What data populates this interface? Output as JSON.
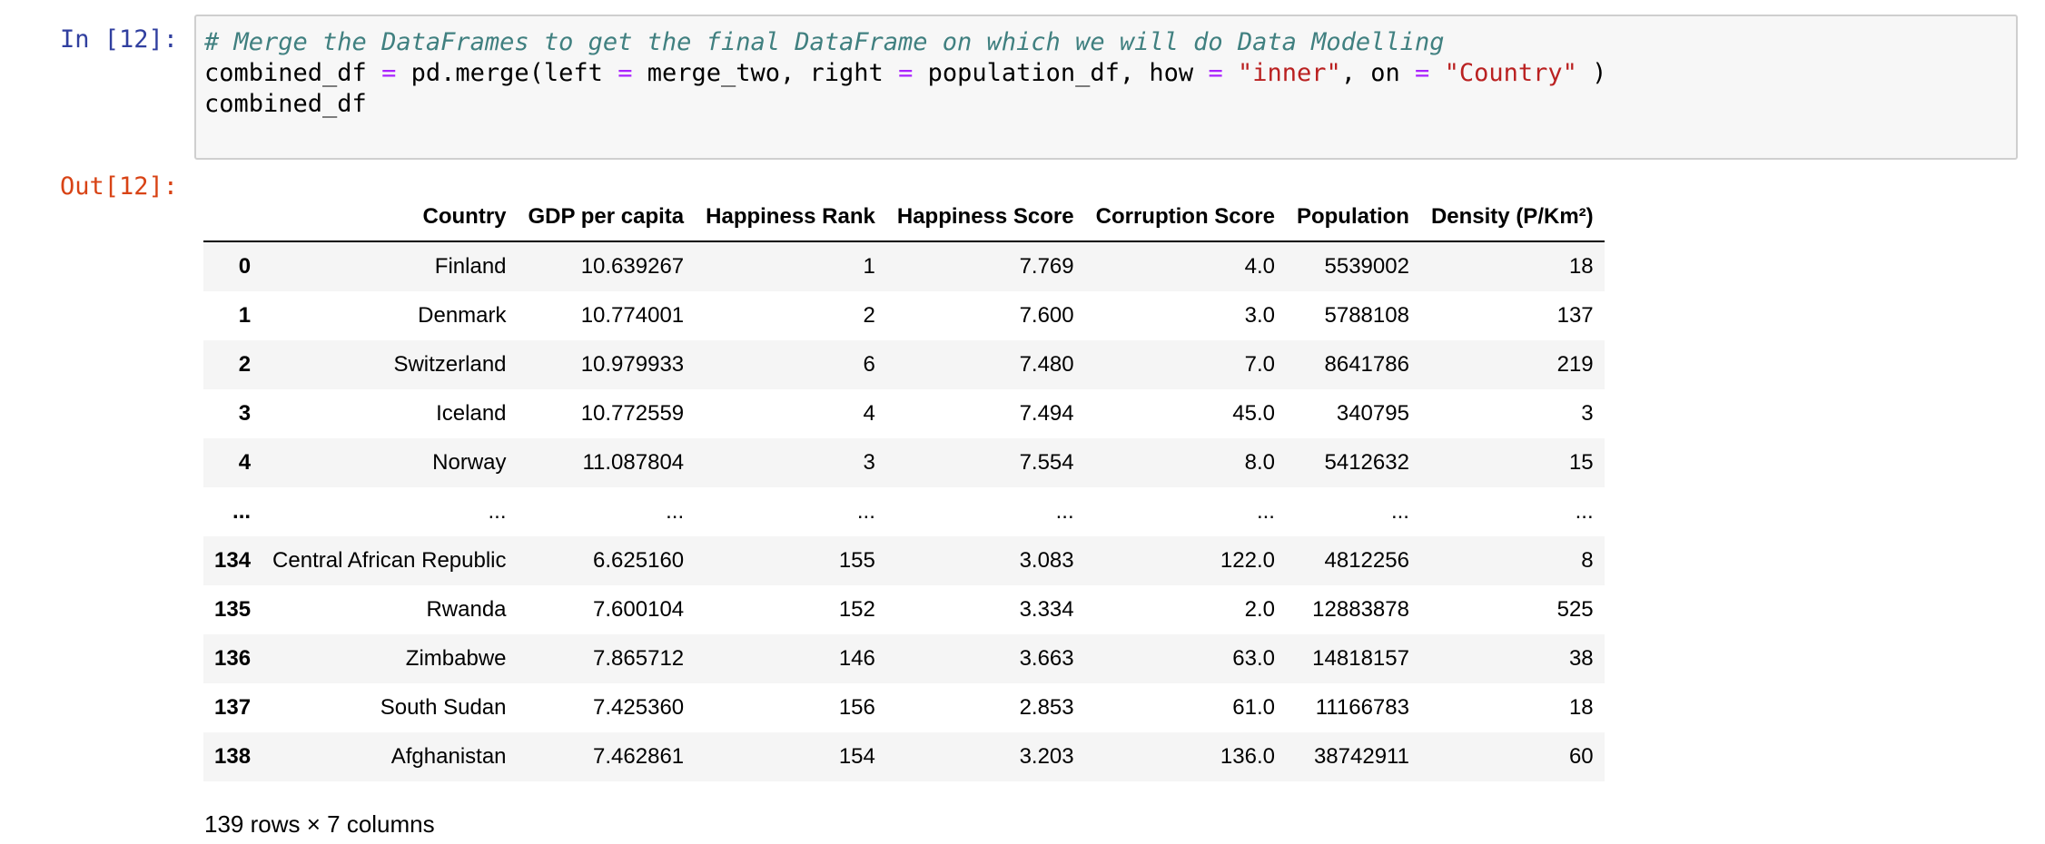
{
  "input_prompt": "In [12]:",
  "output_prompt": "Out[12]:",
  "code_lines": [
    [
      {
        "t": "comment",
        "s": "# Merge the DataFrames to get the final DataFrame on which we will do Data Modelling"
      }
    ],
    [
      {
        "t": "text",
        "s": "combined_df "
      },
      {
        "t": "op",
        "s": "="
      },
      {
        "t": "text",
        "s": " pd.merge(left "
      },
      {
        "t": "op",
        "s": "="
      },
      {
        "t": "text",
        "s": " merge_two, right "
      },
      {
        "t": "op",
        "s": "="
      },
      {
        "t": "text",
        "s": " population_df, how "
      },
      {
        "t": "op",
        "s": "="
      },
      {
        "t": "text",
        "s": " "
      },
      {
        "t": "str",
        "s": "\"inner\""
      },
      {
        "t": "text",
        "s": ", on "
      },
      {
        "t": "op",
        "s": "="
      },
      {
        "t": "text",
        "s": " "
      },
      {
        "t": "str",
        "s": "\"Country\""
      },
      {
        "t": "text",
        "s": " )"
      }
    ],
    [
      {
        "t": "text",
        "s": "combined_df"
      }
    ]
  ],
  "table": {
    "columns": [
      "Country",
      "GDP per capita",
      "Happiness Rank",
      "Happiness Score",
      "Corruption Score",
      "Population",
      "Density (P/Km²)"
    ],
    "rows": [
      {
        "index": "0",
        "cells": [
          "Finland",
          "10.639267",
          "1",
          "7.769",
          "4.0",
          "5539002",
          "18"
        ]
      },
      {
        "index": "1",
        "cells": [
          "Denmark",
          "10.774001",
          "2",
          "7.600",
          "3.0",
          "5788108",
          "137"
        ]
      },
      {
        "index": "2",
        "cells": [
          "Switzerland",
          "10.979933",
          "6",
          "7.480",
          "7.0",
          "8641786",
          "219"
        ]
      },
      {
        "index": "3",
        "cells": [
          "Iceland",
          "10.772559",
          "4",
          "7.494",
          "45.0",
          "340795",
          "3"
        ]
      },
      {
        "index": "4",
        "cells": [
          "Norway",
          "11.087804",
          "3",
          "7.554",
          "8.0",
          "5412632",
          "15"
        ]
      },
      {
        "index": "...",
        "cells": [
          "...",
          "...",
          "...",
          "...",
          "...",
          "...",
          "..."
        ]
      },
      {
        "index": "134",
        "cells": [
          "Central African Republic",
          "6.625160",
          "155",
          "3.083",
          "122.0",
          "4812256",
          "8"
        ]
      },
      {
        "index": "135",
        "cells": [
          "Rwanda",
          "7.600104",
          "152",
          "3.334",
          "2.0",
          "12883878",
          "525"
        ]
      },
      {
        "index": "136",
        "cells": [
          "Zimbabwe",
          "7.865712",
          "146",
          "3.663",
          "63.0",
          "14818157",
          "38"
        ]
      },
      {
        "index": "137",
        "cells": [
          "South Sudan",
          "7.425360",
          "156",
          "2.853",
          "61.0",
          "11166783",
          "18"
        ]
      },
      {
        "index": "138",
        "cells": [
          "Afghanistan",
          "7.462861",
          "154",
          "3.203",
          "136.0",
          "38742911",
          "60"
        ]
      }
    ]
  },
  "shape_text": "139 rows × 7 columns"
}
